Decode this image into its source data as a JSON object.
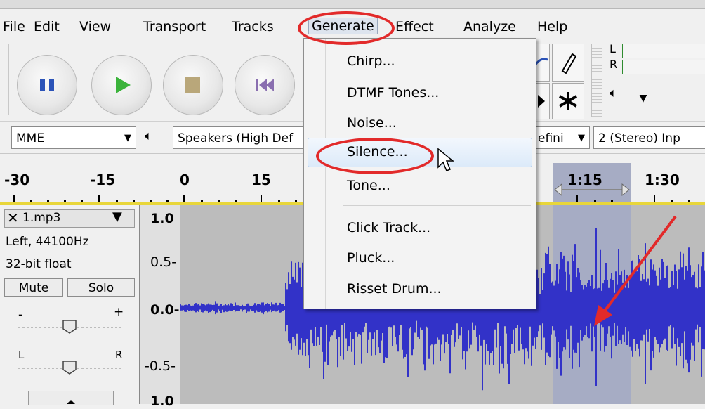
{
  "menubar": {
    "items": [
      "File",
      "Edit",
      "View",
      "Transport",
      "Tracks",
      "Generate",
      "Effect",
      "Analyze",
      "Help"
    ]
  },
  "generate_menu": {
    "items": [
      "Chirp...",
      "DTMF Tones...",
      "Noise...",
      "Silence...",
      "Tone...",
      "Click Track...",
      "Pluck...",
      "Risset Drum..."
    ],
    "highlighted": "Silence..."
  },
  "devices": {
    "host": "MME",
    "output": "Speakers (High Def",
    "output_partial_right": "efini",
    "input_channels": "2 (Stereo) Inp"
  },
  "meter": {
    "left_label": "L",
    "right_label": "R"
  },
  "timeline": {
    "labels": [
      "-30",
      "-15",
      "0",
      "15",
      "1:15",
      "1:30"
    ]
  },
  "track": {
    "name": "1.mp3",
    "info_channel": "Left, 44100Hz",
    "info_format": "32-bit float",
    "mute_label": "Mute",
    "solo_label": "Solo",
    "gain_minus": "-",
    "gain_plus": "+",
    "pan_left": "L",
    "pan_right": "R",
    "vruler_labels": [
      "1.0",
      "0.5-",
      "0.0-",
      "-0.5-",
      "1.0"
    ]
  },
  "colors": {
    "waveform": "#3232c8",
    "annotation": "#e22a2a",
    "selection": "#a6acc4",
    "play_green": "#3bb33b",
    "pause_blue": "#2b53b8"
  }
}
